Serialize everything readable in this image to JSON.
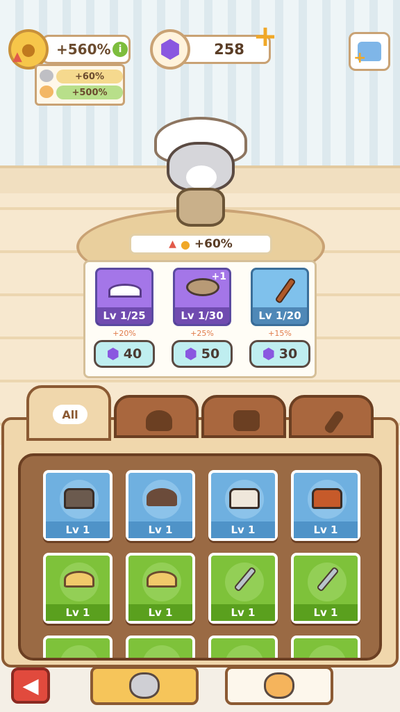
{
  "hud": {
    "coin_bonus": "+560%",
    "info_label": "i",
    "bonus_rows": [
      "+60%",
      "+500%"
    ],
    "gems": "258",
    "plus_label": "+",
    "icons": [
      "coin-paw-icon",
      "gem-icon",
      "wardrobe-icon",
      "info-icon"
    ]
  },
  "stage": {
    "bonus": "+60%",
    "icons": [
      "arrow-up-icon",
      "paw-coin-icon"
    ]
  },
  "equipped": [
    {
      "level": "Lv 1/25",
      "percent": "+20%",
      "cost": "40",
      "slot": "hat",
      "color": "purple"
    },
    {
      "level": "Lv 1/30",
      "percent": "+25%",
      "cost": "50",
      "slot": "outfit",
      "color": "purple",
      "badge": "+1"
    },
    {
      "level": "Lv 1/20",
      "percent": "+15%",
      "cost": "30",
      "slot": "tool",
      "color": "blue"
    }
  ],
  "tabs": [
    {
      "label": "All",
      "icon": null
    },
    {
      "label": "",
      "icon": "chef-hat-icon"
    },
    {
      "label": "",
      "icon": "shirt-icon"
    },
    {
      "label": "",
      "icon": "spatula-icon"
    }
  ],
  "inventory": [
    {
      "level": "Lv 1",
      "color": "blue",
      "item": "apron-dark"
    },
    {
      "level": "Lv 1",
      "color": "blue",
      "item": "hat-brown"
    },
    {
      "level": "Lv 1",
      "color": "blue",
      "item": "apron-light"
    },
    {
      "level": "Lv 1",
      "color": "blue",
      "item": "apron-orange"
    },
    {
      "level": "Lv 1",
      "color": "green",
      "item": "hat-yellow"
    },
    {
      "level": "Lv 1",
      "color": "green",
      "item": "hat-yellow"
    },
    {
      "level": "Lv 1",
      "color": "green",
      "item": "spatula"
    },
    {
      "level": "Lv 1",
      "color": "green",
      "item": "spatula"
    },
    {
      "level": "",
      "color": "green",
      "item": "partial"
    },
    {
      "level": "",
      "color": "green",
      "item": "partial"
    },
    {
      "level": "",
      "color": "green",
      "item": "partial"
    },
    {
      "level": "",
      "color": "green",
      "item": "partial"
    }
  ],
  "bottom": {
    "back_icon": "back-arrow-icon",
    "cats": [
      "gray-cat-icon",
      "orange-cat-icon"
    ]
  },
  "colors": {
    "panel_brown": "#8b5a33",
    "card_blue": "#6fb0e0",
    "card_green": "#7ec23a",
    "gem_purple": "#8a57e0",
    "button_cyan": "#bfeef0"
  }
}
